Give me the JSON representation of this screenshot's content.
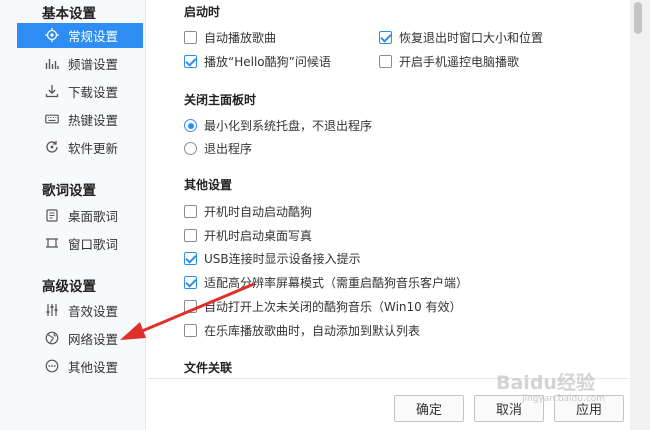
{
  "sidebar": {
    "basic": {
      "heading": "基本设置",
      "items": [
        {
          "label": "常规设置",
          "icon": "target-icon",
          "active": true
        },
        {
          "label": "频谱设置",
          "icon": "spectrum-icon"
        },
        {
          "label": "下载设置",
          "icon": "download-icon"
        },
        {
          "label": "热键设置",
          "icon": "keyboard-icon"
        },
        {
          "label": "软件更新",
          "icon": "update-icon"
        }
      ]
    },
    "lyrics": {
      "heading": "歌词设置",
      "items": [
        {
          "label": "桌面歌词",
          "icon": "desktop-lyrics-icon"
        },
        {
          "label": "窗口歌词",
          "icon": "window-lyrics-icon"
        }
      ]
    },
    "advanced": {
      "heading": "高级设置",
      "items": [
        {
          "label": "音效设置",
          "icon": "equalizer-icon"
        },
        {
          "label": "网络设置",
          "icon": "globe-icon"
        },
        {
          "label": "其他设置",
          "icon": "more-icon"
        }
      ]
    }
  },
  "startup": {
    "title": "启动时",
    "autoplay": {
      "label": "自动播放歌曲",
      "checked": false
    },
    "restore_window": {
      "label": "恢复退出时窗口大小和位置",
      "checked": true
    },
    "greeting": {
      "label": "播放“Hello酷狗”问候语",
      "checked": true
    },
    "remote": {
      "label": "开启手机遥控电脑播歌",
      "checked": false
    }
  },
  "close_panel": {
    "title": "关闭主面板时",
    "minimize": {
      "label": "最小化到系统托盘，不退出程序",
      "checked": true
    },
    "exit": {
      "label": "退出程序",
      "checked": false
    }
  },
  "other": {
    "title": "其他设置",
    "items": [
      {
        "label": "开机时自动启动酷狗",
        "checked": false
      },
      {
        "label": "开机时启动桌面写真",
        "checked": false
      },
      {
        "label": "USB连接时显示设备接入提示",
        "checked": true
      },
      {
        "label": "适配高分辨率屏幕模式（需重启酷狗音乐客户端）",
        "checked": true
      },
      {
        "label": "自动打开上次未关闭的酷狗音乐（Win10 有效）",
        "checked": false
      },
      {
        "label": "在乐库播放歌曲时，自动添加到默认列表",
        "checked": false
      }
    ]
  },
  "file_assoc": {
    "title": "文件关联"
  },
  "footer": {
    "ok": "确定",
    "cancel": "取消",
    "apply": "应用"
  },
  "watermark": {
    "main": "Baidu经验",
    "sub": "jingyan.baidu.com"
  },
  "colors": {
    "accent": "#2d8df2",
    "arrow": "#e0302a"
  }
}
